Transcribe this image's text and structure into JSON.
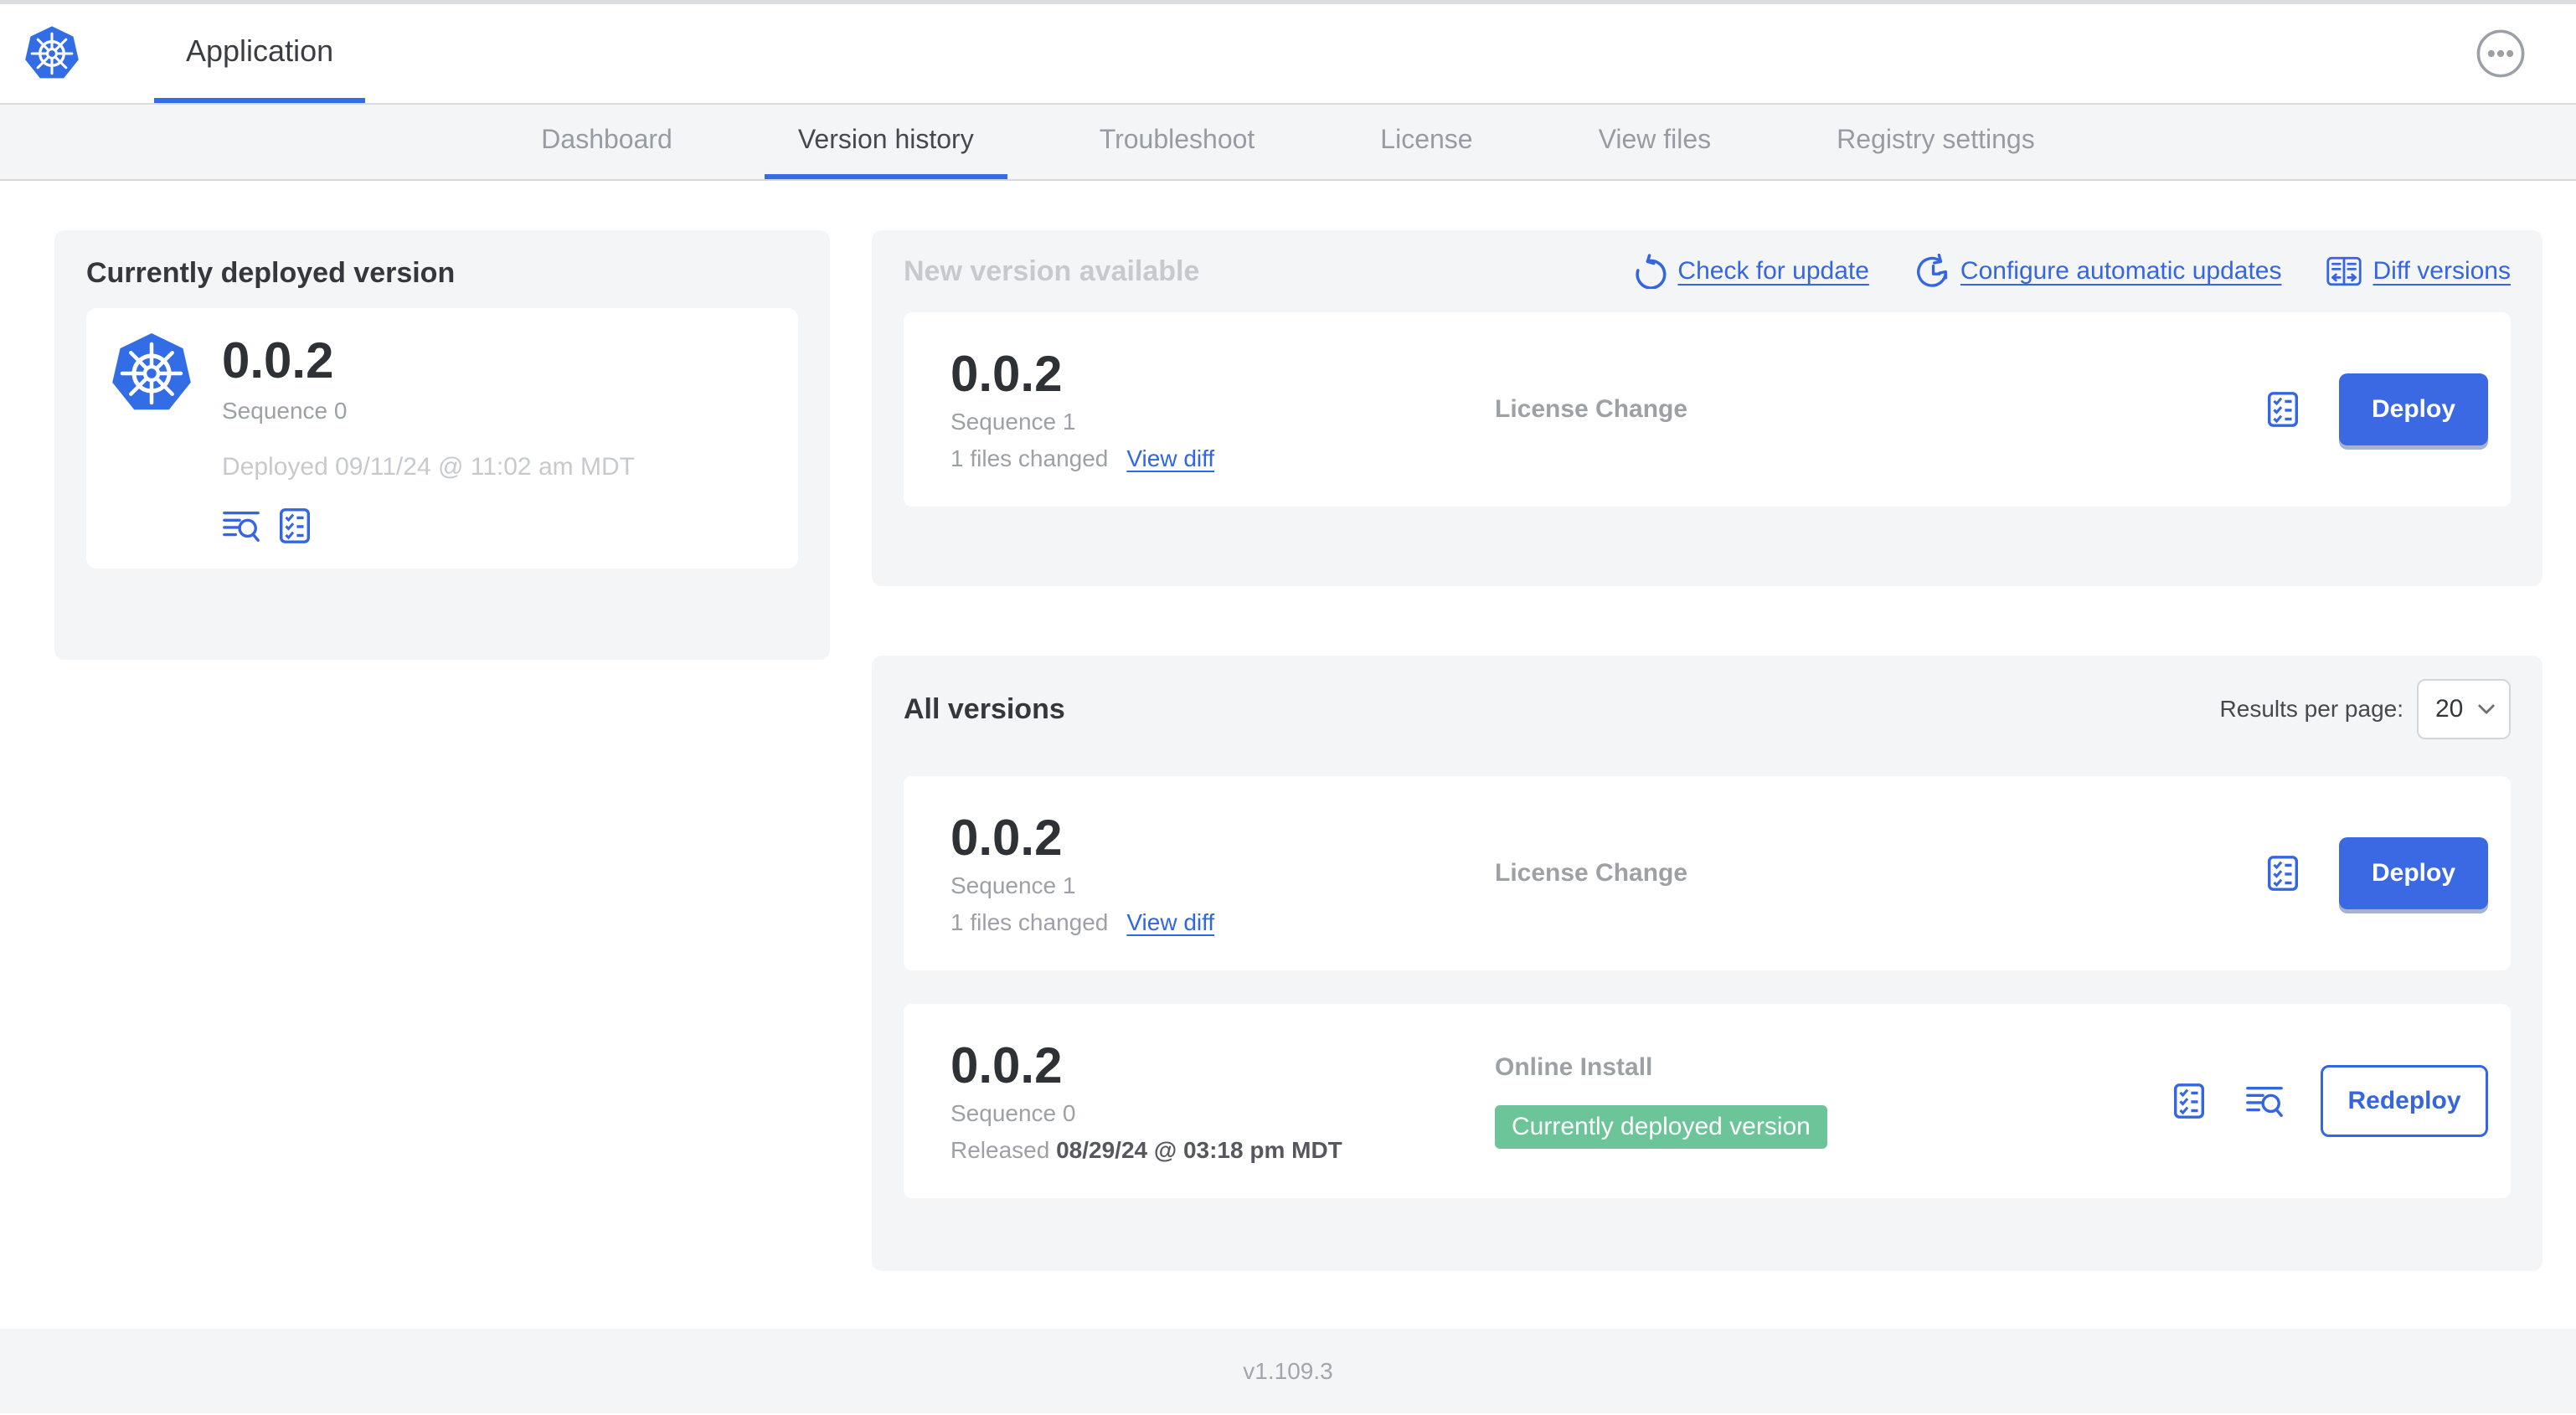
{
  "header": {
    "app_title": "Application"
  },
  "nav": {
    "tabs": [
      {
        "label": "Dashboard"
      },
      {
        "label": "Version history"
      },
      {
        "label": "Troubleshoot"
      },
      {
        "label": "License"
      },
      {
        "label": "View files"
      },
      {
        "label": "Registry settings"
      }
    ]
  },
  "current_deployed": {
    "title": "Currently deployed version",
    "version": "0.0.2",
    "sequence": "Sequence 0",
    "deployed": "Deployed 09/11/24 @ 11:02 am MDT"
  },
  "new_version": {
    "title": "New version available",
    "actions": {
      "check_for_update": "Check for update",
      "configure_automatic_updates": "Configure automatic updates",
      "diff_versions": "Diff versions"
    },
    "card": {
      "version": "0.0.2",
      "sequence": "Sequence 1",
      "files_changed": "1 files changed",
      "view_diff": "View diff",
      "source": "License Change",
      "action_label": "Deploy"
    }
  },
  "all_versions": {
    "title": "All versions",
    "results_per_page": {
      "label": "Results per page:",
      "value": "20"
    },
    "rows": [
      {
        "version": "0.0.2",
        "sequence": "Sequence 1",
        "files_changed": "1 files changed",
        "view_diff": "View diff",
        "source": "License Change",
        "action_label": "Deploy"
      },
      {
        "version": "0.0.2",
        "sequence": "Sequence 0",
        "released_label": "Released",
        "released_date": "08/29/24 @ 03:18 pm MDT",
        "source": "Online Install",
        "badge": "Currently deployed version",
        "action_label": "Redeploy"
      }
    ]
  },
  "footer": {
    "app_version": "v1.109.3"
  },
  "colors": {
    "accent_blue": "#3566e0",
    "kubernetes_blue": "#326de6",
    "badge_green": "#6cc599"
  }
}
